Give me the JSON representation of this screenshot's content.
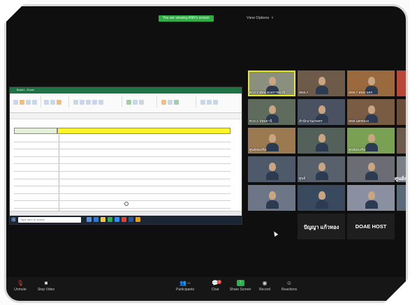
{
  "window": {
    "share_banner": "You are viewing ANN's screen",
    "view_options": "View Options"
  },
  "shared_screen": {
    "app": "Excel",
    "title_bar": "Book1 - Excel",
    "sheet_title": "",
    "header_cells": [
      "",
      ""
    ],
    "rows": [
      {
        "a": "",
        "b": ""
      },
      {
        "a": "",
        "b": ""
      },
      {
        "a": "",
        "b": ""
      },
      {
        "a": "",
        "b": ""
      },
      {
        "a": "",
        "b": ""
      },
      {
        "a": "",
        "b": ""
      },
      {
        "a": "",
        "b": ""
      },
      {
        "a": "",
        "b": ""
      },
      {
        "a": "",
        "b": ""
      },
      {
        "a": "",
        "b": ""
      },
      {
        "a": "",
        "b": ""
      },
      {
        "a": "",
        "b": ""
      },
      {
        "a": "",
        "b": ""
      }
    ],
    "taskbar": {
      "search_placeholder": "Type here to search",
      "clock_time": "",
      "clock_date": ""
    }
  },
  "gallery": {
    "tiles": [
      {
        "name": "ศวภ.7 สพพ.อุบลราชธานี",
        "bg": "#8a8f7e"
      },
      {
        "name": "สพท.7",
        "bg": "#6d5a48"
      },
      {
        "name": "สพท.7 สพพ.นคร",
        "bg": "#9a6a3e"
      },
      {
        "name": "",
        "bg": "#b8483a"
      },
      {
        "name": "ศวภ.1 ปทุมธานี",
        "bg": "#5f6b5c"
      },
      {
        "name": "สำนักงานเกษตร",
        "bg": "#4a5160"
      },
      {
        "name": "สพท.นครพนม",
        "bg": "#7a5b44"
      },
      {
        "name": "",
        "bg": "#6a4d3a"
      },
      {
        "name": "ศูนย์ส่งเสริม",
        "bg": "#9b7a52"
      },
      {
        "name": "",
        "bg": "#53615a"
      },
      {
        "name": "ศูนย์ส่งเสริม",
        "bg": "#7aa153"
      },
      {
        "name": "",
        "bg": "#6d5c4e"
      },
      {
        "name": "",
        "bg": "#4e5a6a"
      },
      {
        "name": "ศูนย์",
        "bg": "#58606b"
      },
      {
        "name": "",
        "bg": "#6c6c74"
      },
      {
        "name": "",
        "bg": "#7b8088"
      },
      {
        "name": "",
        "bg": "#6d7686"
      },
      {
        "name": "",
        "bg": "#3a4a5e"
      },
      {
        "name": "",
        "bg": "#8a90a0"
      },
      {
        "name": "",
        "bg": "#5a6a78"
      }
    ],
    "name_only_tiles": [
      "ปัญญา แก้วทอง",
      "DOAE HOST"
    ],
    "cut_off_label": "ศูนย์ส่ง"
  },
  "controls": {
    "unmute": "Unmute",
    "stop_video": "Stop Video",
    "participants": "Participants",
    "participants_count": "22",
    "chat": "Chat",
    "chat_badge": "1",
    "share_screen": "Share Screen",
    "record": "Record",
    "reactions": "Reactions"
  },
  "colors": {
    "share_banner_bg": "#2fae46",
    "excel_green": "#1f7244",
    "active_speaker": "#e7e81a",
    "muted_red": "#e33333"
  }
}
